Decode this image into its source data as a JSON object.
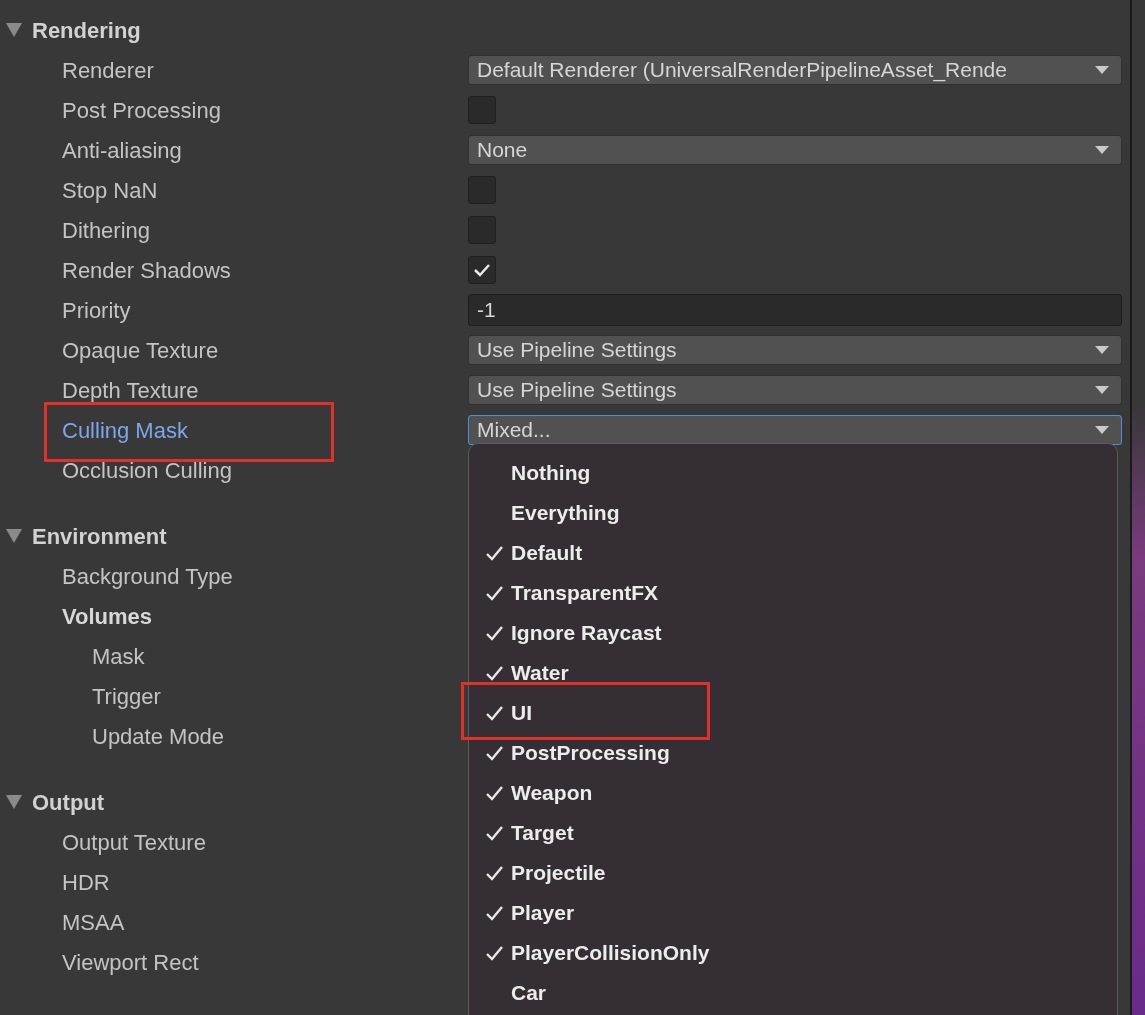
{
  "sections": [
    {
      "title": "Rendering",
      "expanded": true,
      "rows": [
        {
          "label": "Renderer",
          "kind": "dropdown",
          "value": "Default Renderer (UniversalRenderPipelineAsset_Rende"
        },
        {
          "label": "Post Processing",
          "kind": "checkbox",
          "checked": false
        },
        {
          "label": "Anti-aliasing",
          "kind": "dropdown",
          "value": "None"
        },
        {
          "label": "Stop NaN",
          "kind": "checkbox",
          "checked": false
        },
        {
          "label": "Dithering",
          "kind": "checkbox",
          "checked": false
        },
        {
          "label": "Render Shadows",
          "kind": "checkbox",
          "checked": true
        },
        {
          "label": "Priority",
          "kind": "number",
          "value": "-1"
        },
        {
          "label": "Opaque Texture",
          "kind": "dropdown",
          "value": "Use Pipeline Settings"
        },
        {
          "label": "Depth Texture",
          "kind": "dropdown",
          "value": "Use Pipeline Settings"
        },
        {
          "label": "Culling Mask",
          "kind": "dropdown",
          "value": "Mixed...",
          "focused": true,
          "highlighted": true
        },
        {
          "label": "Occlusion Culling",
          "kind": "label"
        }
      ]
    },
    {
      "title": "Environment",
      "expanded": true,
      "rows": [
        {
          "label": "Background Type",
          "kind": "label"
        },
        {
          "label": "Volumes",
          "kind": "group",
          "children": [
            {
              "label": "Mask",
              "kind": "label"
            },
            {
              "label": "Trigger",
              "kind": "label"
            },
            {
              "label": "Update Mode",
              "kind": "label"
            }
          ]
        }
      ]
    },
    {
      "title": "Output",
      "expanded": true,
      "rows": [
        {
          "label": "Output Texture",
          "kind": "label"
        },
        {
          "label": "HDR",
          "kind": "label"
        },
        {
          "label": "MSAA",
          "kind": "label"
        },
        {
          "label": "Viewport Rect",
          "kind": "label"
        }
      ]
    }
  ],
  "menu": {
    "items": [
      {
        "label": "Nothing",
        "checked": false
      },
      {
        "label": "Everything",
        "checked": false
      },
      {
        "label": "Default",
        "checked": true
      },
      {
        "label": "TransparentFX",
        "checked": true
      },
      {
        "label": "Ignore Raycast",
        "checked": true
      },
      {
        "label": "Water",
        "checked": true
      },
      {
        "label": "UI",
        "checked": true,
        "highlighted": true
      },
      {
        "label": "PostProcessing",
        "checked": true
      },
      {
        "label": "Weapon",
        "checked": true
      },
      {
        "label": "Target",
        "checked": true
      },
      {
        "label": "Projectile",
        "checked": true
      },
      {
        "label": "Player",
        "checked": true
      },
      {
        "label": "PlayerCollisionOnly",
        "checked": true
      },
      {
        "label": "Car",
        "checked": false
      }
    ]
  }
}
